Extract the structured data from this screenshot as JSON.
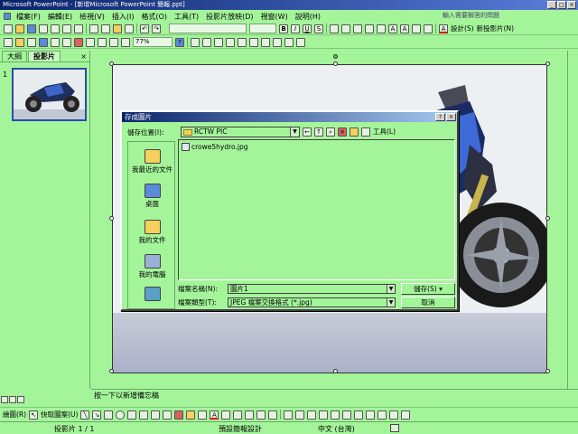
{
  "window": {
    "title": "Microsoft PowerPoint - [新增Microsoft PowerPoint 簡報.ppt]"
  },
  "menu": {
    "items": [
      "檔案(F)",
      "編輯(E)",
      "檢視(V)",
      "插入(I)",
      "格式(O)",
      "工具(T)",
      "投影片放映(D)",
      "視窗(W)",
      "說明(H)"
    ],
    "help_placeholder": "輸入需要解答的問題"
  },
  "toolbar2": {
    "zoom": "77%",
    "design_label": "設計(S)",
    "new_slide_label": "新投影片(N)"
  },
  "left_pane": {
    "tab_outline": "大綱",
    "tab_slides": "投影片",
    "slide_number": "1"
  },
  "notes": {
    "placeholder": "按一下以新增備忘稿"
  },
  "drawing": {
    "draw_label": "繪圖(R)",
    "autoshapes_label": "快取圖案(U)"
  },
  "status": {
    "slide_pos": "投影片 1 / 1",
    "design": "預設簡報設計",
    "language": "中文 (台灣)"
  },
  "dialog": {
    "title": "存成圖片",
    "look_in_label": "儲存位置(I):",
    "look_in_value": "RCTW PIC",
    "tools_label": "工具(L)",
    "places": [
      "我最近的文件",
      "桌面",
      "我的文件",
      "我的電腦"
    ],
    "files": [
      "crowe5hydro.jpg"
    ],
    "filename_label": "檔案名稱(N):",
    "filename_value": "圖片1",
    "filetype_label": "檔案類型(T):",
    "filetype_value": "JPEG 檔案交換格式 (*.jpg)",
    "save_label": "儲存(S)",
    "cancel_label": "取消"
  }
}
